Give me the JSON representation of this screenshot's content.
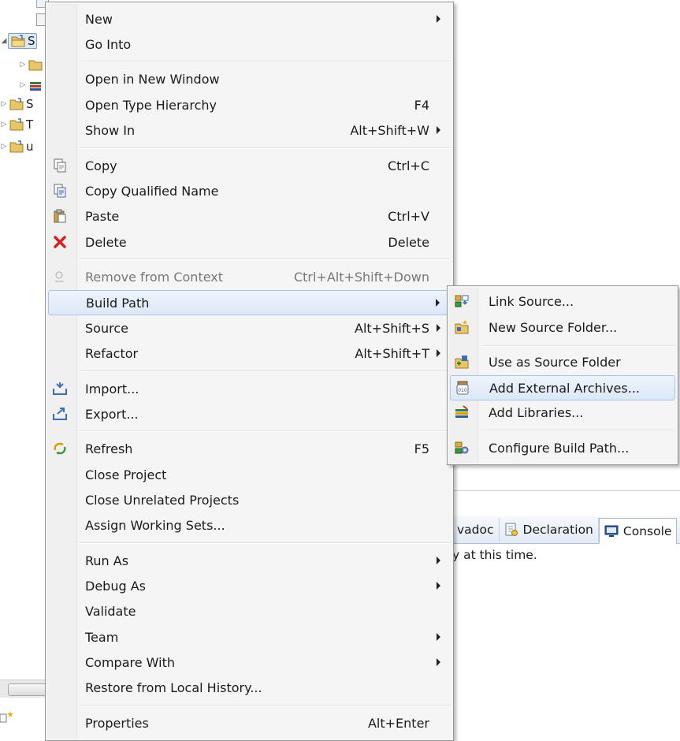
{
  "explorer": {
    "items": [
      {
        "label": "S",
        "indent": 0,
        "twisty": "expanded",
        "selected": true
      },
      {
        "label": "",
        "indent": 1,
        "twisty": "collapsed",
        "selected": false
      },
      {
        "label": "",
        "indent": 1,
        "twisty": "collapsed",
        "selected": false
      },
      {
        "label": "S",
        "indent": 0,
        "twisty": "collapsed",
        "selected": false
      },
      {
        "label": "T",
        "indent": 0,
        "twisty": "collapsed",
        "selected": false
      },
      {
        "label": "u",
        "indent": 0,
        "twisty": "collapsed",
        "selected": false
      }
    ]
  },
  "console": {
    "tabs": [
      {
        "label": "vadoc"
      },
      {
        "label": "Declaration"
      },
      {
        "label": "Console"
      }
    ],
    "message": "y at this time."
  },
  "context_menu": {
    "groups": [
      [
        {
          "label": "New",
          "shortcut": "",
          "submenu": true
        },
        {
          "label": "Go Into",
          "shortcut": "",
          "submenu": false
        }
      ],
      [
        {
          "label": "Open in New Window",
          "shortcut": "",
          "submenu": false
        },
        {
          "label": "Open Type Hierarchy",
          "shortcut": "F4",
          "submenu": false
        },
        {
          "label": "Show In",
          "shortcut": "Alt+Shift+W",
          "submenu": true
        }
      ],
      [
        {
          "label": "Copy",
          "shortcut": "Ctrl+C",
          "icon": "copy-icon"
        },
        {
          "label": "Copy Qualified Name",
          "shortcut": "",
          "icon": "copy-qualified-icon"
        },
        {
          "label": "Paste",
          "shortcut": "Ctrl+V",
          "icon": "paste-icon"
        },
        {
          "label": "Delete",
          "shortcut": "Delete",
          "icon": "delete-icon"
        }
      ],
      [
        {
          "label": "Remove from Context",
          "shortcut": "Ctrl+Alt+Shift+Down",
          "disabled": true,
          "icon": "remove-context-icon"
        },
        {
          "label": "Build Path",
          "shortcut": "",
          "submenu": true,
          "highlighted": true
        },
        {
          "label": "Source",
          "shortcut": "Alt+Shift+S",
          "submenu": true
        },
        {
          "label": "Refactor",
          "shortcut": "Alt+Shift+T",
          "submenu": true
        }
      ],
      [
        {
          "label": "Import...",
          "shortcut": "",
          "icon": "import-icon"
        },
        {
          "label": "Export...",
          "shortcut": "",
          "icon": "export-icon"
        }
      ],
      [
        {
          "label": "Refresh",
          "shortcut": "F5",
          "icon": "refresh-icon"
        },
        {
          "label": "Close Project",
          "shortcut": ""
        },
        {
          "label": "Close Unrelated Projects",
          "shortcut": ""
        },
        {
          "label": "Assign Working Sets...",
          "shortcut": ""
        }
      ],
      [
        {
          "label": "Run As",
          "shortcut": "",
          "submenu": true
        },
        {
          "label": "Debug As",
          "shortcut": "",
          "submenu": true
        },
        {
          "label": "Validate",
          "shortcut": ""
        },
        {
          "label": "Team",
          "shortcut": "",
          "submenu": true
        },
        {
          "label": "Compare With",
          "shortcut": "",
          "submenu": true
        },
        {
          "label": "Restore from Local History...",
          "shortcut": ""
        }
      ],
      [
        {
          "label": "Properties",
          "shortcut": "Alt+Enter"
        }
      ]
    ]
  },
  "build_path_submenu": {
    "groups": [
      [
        {
          "label": "Link Source...",
          "icon": "link-source-icon"
        },
        {
          "label": "New Source Folder...",
          "icon": "new-source-folder-icon"
        }
      ],
      [
        {
          "label": "Use as Source Folder",
          "icon": "use-as-source-folder-icon"
        },
        {
          "label": "Add External Archives...",
          "icon": "jar-icon",
          "highlighted": true
        },
        {
          "label": "Add Libraries...",
          "icon": "library-icon"
        }
      ],
      [
        {
          "label": "Configure Build Path...",
          "icon": "configure-build-path-icon"
        }
      ]
    ]
  },
  "colors": {
    "menu_background": "#f5f5f5",
    "menu_gutter": "#f0f0f0",
    "highlight_border": "#a8c4e6",
    "disabled_text": "#777777",
    "delete_red": "#d62020"
  }
}
